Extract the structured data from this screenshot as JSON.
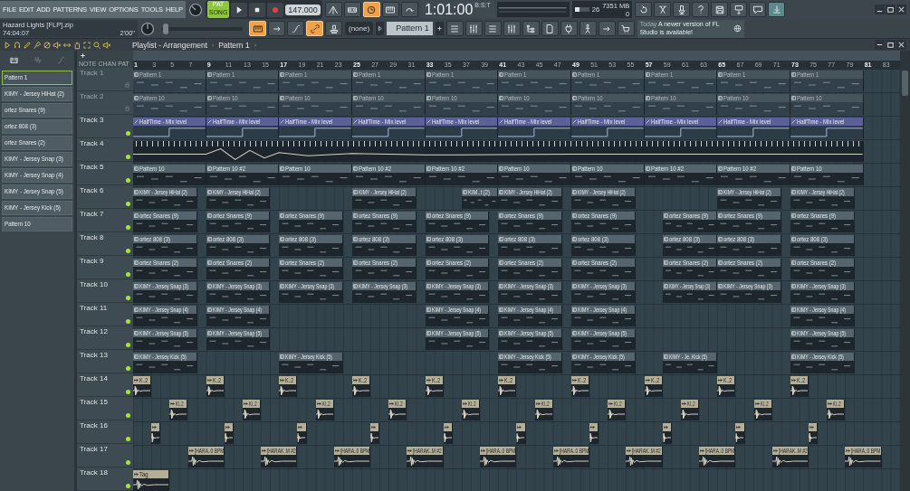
{
  "menu": [
    "FILE",
    "EDIT",
    "ADD",
    "PATTERNS",
    "VIEW",
    "OPTIONS",
    "TOOLS",
    "HELP"
  ],
  "project": {
    "file": "Hazard Lights [FLP].zip",
    "elapsed": "74:04:07",
    "length": "2'00\""
  },
  "transport": {
    "mode_song": "SONG",
    "mode_pat": "PAT",
    "song_mode": true,
    "recording": true,
    "tempo": "147.000"
  },
  "time": {
    "value": "1:01:00",
    "unit": "B:S:T"
  },
  "resources": {
    "cpu": "26",
    "memory": "7351 MB",
    "polyphony": "0",
    "level": 0.35
  },
  "pitch": {
    "level": 0.02
  },
  "buttons_top": [
    {
      "on": false
    },
    {
      "on": false
    },
    {
      "on": true
    },
    {
      "on": false
    },
    {
      "on": false
    }
  ],
  "buttons_top_right": [
    {
      "on": false
    },
    {
      "on": false
    },
    {
      "on": false
    },
    {
      "on": false
    },
    {
      "on": false
    },
    {
      "on": false
    },
    {
      "on": false
    },
    {
      "on": true
    }
  ],
  "buttons_mid": [
    {
      "on": true
    },
    {
      "on": false
    },
    {
      "on": false
    },
    {
      "on": true
    },
    {
      "on": false
    }
  ],
  "snap": "(none)",
  "pattern_selector": "Pattern 1",
  "buttons_mid_right": [
    {
      "on": false
    },
    {
      "on": false
    },
    {
      "on": false
    },
    {
      "on": false
    },
    {
      "on": false
    },
    {
      "on": false
    },
    {
      "on": false
    },
    {
      "on": false
    },
    {
      "on": false
    },
    {
      "on": false
    }
  ],
  "news": {
    "date": "Today",
    "message": "A newer version of FL Studio is available!"
  },
  "playlist": {
    "title": "Playlist - Arrangement",
    "breadcrumb": "Pattern 1",
    "modes": [
      "NOTE",
      "CHAN",
      "PAT"
    ],
    "ruler": [
      "1",
      "3",
      "5",
      "7",
      "9",
      "11",
      "13",
      "15",
      "17",
      "19",
      "21",
      "23",
      "25",
      "27",
      "29",
      "31",
      "33",
      "35",
      "37",
      "39",
      "41",
      "43",
      "45",
      "47",
      "49",
      "51",
      "53",
      "55",
      "57",
      "59",
      "61",
      "63",
      "65",
      "67",
      "69",
      "71",
      "73",
      "75",
      "77",
      "79",
      "81",
      "83"
    ]
  },
  "patterns": [
    {
      "label": "Pattern 1",
      "selected": true
    },
    {
      "label": "KIMY - Jersey HiHat (2)",
      "selected": false
    },
    {
      "label": "ortez Snares (9)",
      "selected": false
    },
    {
      "label": "ortez 808  (3)",
      "selected": false
    },
    {
      "label": "ortez Snares (2)",
      "selected": false
    },
    {
      "label": "KIMY - Jersey Snap (3)",
      "selected": false
    },
    {
      "label": "KIMY - Jersey Snap (4)",
      "selected": false
    },
    {
      "label": "KIMY - Jersey Snap (5)",
      "selected": false
    },
    {
      "label": "KIMY - Jersey Kick (5)",
      "selected": false
    },
    {
      "label": "Pattern 10",
      "selected": false
    }
  ],
  "tracks": [
    {
      "name": "Track 1",
      "enabled": false,
      "clips": [
        {
          "kind": "pattern",
          "label": "Pattern 1"
        },
        {
          "kind": "pattern",
          "label": "Pattern 1"
        },
        {
          "kind": "pattern",
          "label": "Pattern 1"
        },
        {
          "kind": "pattern",
          "label": "Pattern 1"
        },
        {
          "kind": "pattern",
          "label": "Pattern 1"
        },
        {
          "kind": "pattern",
          "label": "Pattern 1"
        },
        {
          "kind": "pattern",
          "label": "Pattern 1"
        },
        {
          "kind": "pattern",
          "label": "Pattern 1"
        },
        {
          "kind": "pattern",
          "label": "Pattern 1"
        },
        {
          "kind": "pattern",
          "label": "Pattern 1"
        }
      ]
    },
    {
      "name": "Track 2",
      "enabled": false,
      "clips": [
        {
          "kind": "pattern",
          "label": "Pattern 10"
        },
        {
          "kind": "pattern",
          "label": "Pattern 10"
        },
        {
          "kind": "pattern",
          "label": "Pattern 10"
        },
        {
          "kind": "pattern",
          "label": "Pattern 10"
        },
        {
          "kind": "pattern",
          "label": "Pattern 10"
        },
        {
          "kind": "pattern",
          "label": "Pattern 10"
        },
        {
          "kind": "pattern",
          "label": "Pattern 10"
        },
        {
          "kind": "pattern",
          "label": "Pattern 10"
        },
        {
          "kind": "pattern",
          "label": "Pattern 10"
        },
        {
          "kind": "pattern",
          "label": "Pattern 10"
        }
      ]
    },
    {
      "name": "Track 3",
      "enabled": true,
      "clips": [
        {
          "kind": "automation",
          "label": "HalfTime - Mix level"
        },
        {
          "kind": "automation",
          "label": "HalfTime - Mix level"
        },
        {
          "kind": "automation",
          "label": "HalfTime - Mix level"
        },
        {
          "kind": "automation",
          "label": "HalfTime - Mix level"
        },
        {
          "kind": "automation",
          "label": "HalfTime - Mix level"
        },
        {
          "kind": "automation",
          "label": "HalfTime - Mix level"
        },
        {
          "kind": "automation",
          "label": "HalfTime - Mix level"
        },
        {
          "kind": "automation",
          "label": "HalfTime - Mix level"
        },
        {
          "kind": "automation",
          "label": "HalfTime - Mix level"
        },
        {
          "kind": "automation",
          "label": "HalfTime - Mix level"
        }
      ]
    },
    {
      "name": "Track 4",
      "enabled": true,
      "clips": [
        {
          "kind": "strip"
        }
      ]
    },
    {
      "name": "Track 5",
      "enabled": true,
      "clips": [
        {
          "kind": "pattern",
          "label": "Pattern 10"
        },
        {
          "kind": "pattern",
          "label": "Pattern 10 #2"
        },
        {
          "kind": "pattern",
          "label": "Pattern 10"
        },
        {
          "kind": "pattern",
          "label": "Pattern 10 #2"
        },
        {
          "kind": "pattern",
          "label": "Pattern 10 #2"
        },
        {
          "kind": "pattern",
          "label": "Pattern 10"
        },
        {
          "kind": "pattern",
          "label": "Pattern 10"
        },
        {
          "kind": "pattern",
          "label": "Pattern 10 #2"
        },
        {
          "kind": "pattern",
          "label": "Pattern 10 #2"
        },
        {
          "kind": "pattern",
          "label": "Pattern 10"
        }
      ]
    },
    {
      "name": "Track 6",
      "enabled": true,
      "clips": [
        {
          "kind": "pattern",
          "label": "KIMY - Jersey HiHat (2)"
        },
        {
          "kind": "pattern",
          "label": "KIMY - Jersey HiHat (2)"
        },
        {
          "kind": "pattern",
          "label": "KIMY - Jersey HiHat (2)"
        },
        {
          "kind": "pattern",
          "label": "KIM..t (2)"
        },
        {
          "kind": "pattern",
          "label": "KIMY - Jersey HiHat (2)"
        },
        {
          "kind": "pattern",
          "label": "KIMY - Jersey HiHat (2)"
        },
        {
          "kind": "pattern",
          "label": "KIMY - Jersey HiHat (2)"
        },
        {
          "kind": "pattern",
          "label": "KIMY - Jersey HiHat (2)"
        }
      ]
    },
    {
      "name": "Track 7",
      "enabled": true,
      "clips": [
        {
          "kind": "pattern",
          "label": "ortez Snares (9)"
        },
        {
          "kind": "pattern",
          "label": "ortez Snares (9)"
        },
        {
          "kind": "pattern",
          "label": "ortez Snares (9)"
        },
        {
          "kind": "pattern",
          "label": "ortez Snares (9)"
        },
        {
          "kind": "pattern",
          "label": "ortez Snares (9)"
        },
        {
          "kind": "pattern",
          "label": "ortez Snares (9)"
        },
        {
          "kind": "pattern",
          "label": "ortez Snares (9)"
        },
        {
          "kind": "pattern",
          "label": "ortez Snares (9)"
        },
        {
          "kind": "pattern",
          "label": "ortez Snares (9)"
        },
        {
          "kind": "pattern",
          "label": "ortez Snares (9)"
        }
      ]
    },
    {
      "name": "Track 8",
      "enabled": true,
      "clips": [
        {
          "kind": "pattern",
          "label": "ortez 808  (3)"
        },
        {
          "kind": "pattern",
          "label": "ortez 808  (3)"
        },
        {
          "kind": "pattern",
          "label": "ortez 808  (3)"
        },
        {
          "kind": "pattern",
          "label": "ortez 808  (3)"
        },
        {
          "kind": "pattern",
          "label": "ortez 808  (3)"
        },
        {
          "kind": "pattern",
          "label": "ortez 808  (3)"
        },
        {
          "kind": "pattern",
          "label": "ortez 808  (3)"
        },
        {
          "kind": "pattern",
          "label": "ortez 808  (3)"
        },
        {
          "kind": "pattern",
          "label": "ortez 808  (3)"
        },
        {
          "kind": "pattern",
          "label": "ortez 808  (3)"
        }
      ]
    },
    {
      "name": "Track 9",
      "enabled": true,
      "clips": [
        {
          "kind": "pattern",
          "label": "ortez Snares (2)"
        },
        {
          "kind": "pattern",
          "label": "ortez Snares (2)"
        },
        {
          "kind": "pattern",
          "label": "ortez Snares (2)"
        },
        {
          "kind": "pattern",
          "label": "ortez Snares (2)"
        },
        {
          "kind": "pattern",
          "label": "ortez Snares (2)"
        },
        {
          "kind": "pattern",
          "label": "ortez Snares (2)"
        },
        {
          "kind": "pattern",
          "label": "ortez Snares (2)"
        },
        {
          "kind": "pattern",
          "label": "ortez Snares (2)"
        },
        {
          "kind": "pattern",
          "label": "ortez Snares (2)"
        },
        {
          "kind": "pattern",
          "label": "ortez Snares (2)"
        }
      ]
    },
    {
      "name": "Track 10",
      "enabled": true,
      "clips": [
        {
          "kind": "pattern",
          "label": "KIMY - Jersey Snap (3)"
        },
        {
          "kind": "pattern",
          "label": "KIMY - Jersey Snap (3)"
        },
        {
          "kind": "pattern",
          "label": "KIMY - Jersey Snap (3)"
        },
        {
          "kind": "pattern",
          "label": "KIMY - Jersey Snap (3)"
        },
        {
          "kind": "pattern",
          "label": "KIMY - Jersey Snap (3)"
        },
        {
          "kind": "pattern",
          "label": "KIMY - Jersey Snap (3)"
        },
        {
          "kind": "pattern",
          "label": "KIMY - Jersey Snap (3)"
        },
        {
          "kind": "pattern",
          "label": "KIMY - Jersey Snap (3)"
        },
        {
          "kind": "pattern",
          "label": "KIMY - Jersey Snap (3)"
        },
        {
          "kind": "pattern",
          "label": "KIMY - Jersey Snap (3)"
        }
      ]
    },
    {
      "name": "Track 11",
      "enabled": true,
      "clips": [
        {
          "kind": "pattern",
          "label": "KIMY - Jersey Snap (4)"
        },
        {
          "kind": "pattern",
          "label": "KIMY - Jersey Snap (4)"
        },
        {
          "kind": "pattern",
          "label": "KIMY - Jersey Snap (4)"
        },
        {
          "kind": "pattern",
          "label": "KIMY - Jersey Snap (4)"
        },
        {
          "kind": "pattern",
          "label": "KIMY - Jersey Snap (4)"
        },
        {
          "kind": "pattern",
          "label": "KIMY - Jersey Snap (4)"
        }
      ]
    },
    {
      "name": "Track 12",
      "enabled": true,
      "clips": [
        {
          "kind": "pattern",
          "label": "KIMY - Jersey Snap (5)"
        },
        {
          "kind": "pattern",
          "label": "KIMY - Jersey Snap (5)"
        },
        {
          "kind": "pattern",
          "label": "KIMY - Jersey Snap (5)"
        },
        {
          "kind": "pattern",
          "label": "KIMY - Jersey Snap (5)"
        },
        {
          "kind": "pattern",
          "label": "KIMY - Jersey Snap (5)"
        },
        {
          "kind": "pattern",
          "label": "KIMY - Jersey Snap (5)"
        }
      ]
    },
    {
      "name": "Track 13",
      "enabled": true,
      "clips": [
        {
          "kind": "pattern",
          "label": "KIMY - Jersey Kick (5)"
        },
        {
          "kind": "pattern",
          "label": "KIMY - Jersey Kick (5)"
        },
        {
          "kind": "pattern",
          "label": "KIMY - Jersey Kick (5)"
        },
        {
          "kind": "pattern",
          "label": "KIMY - Jersey Kick (5)"
        },
        {
          "kind": "pattern",
          "label": "KIMY - Je..Kick (5)"
        },
        {
          "kind": "pattern",
          "label": "KIMY - Jersey Kick (5)"
        }
      ]
    },
    {
      "name": "Track 14",
      "enabled": true,
      "clips": [
        {
          "kind": "audio",
          "label": "K..2"
        },
        {
          "kind": "audio",
          "label": "K..2"
        },
        {
          "kind": "audio",
          "label": "K..2"
        },
        {
          "kind": "audio",
          "label": "K..2"
        },
        {
          "kind": "audio",
          "label": "K..2"
        },
        {
          "kind": "audio",
          "label": "K..2"
        },
        {
          "kind": "audio",
          "label": "K..2"
        },
        {
          "kind": "audio",
          "label": "K..2"
        },
        {
          "kind": "audio",
          "label": "K..2"
        },
        {
          "kind": "audio",
          "label": "K..2"
        }
      ]
    },
    {
      "name": "Track 15",
      "enabled": true,
      "clips": [
        {
          "kind": "audio",
          "label": "KI..2"
        },
        {
          "kind": "audio",
          "label": "KI..2"
        },
        {
          "kind": "audio",
          "label": "KI..2"
        },
        {
          "kind": "audio",
          "label": "KI..2"
        },
        {
          "kind": "audio",
          "label": "KI..2"
        },
        {
          "kind": "audio",
          "label": "KI..2"
        },
        {
          "kind": "audio",
          "label": "KI..2"
        },
        {
          "kind": "audio",
          "label": "KI..2"
        },
        {
          "kind": "audio",
          "label": "KI..2"
        },
        {
          "kind": "audio",
          "label": "KI..2"
        }
      ]
    },
    {
      "name": "Track 16",
      "enabled": true,
      "clips": [
        {
          "kind": "audio"
        },
        {
          "kind": "audio"
        },
        {
          "kind": "audio"
        },
        {
          "kind": "audio"
        },
        {
          "kind": "audio"
        },
        {
          "kind": "audio"
        },
        {
          "kind": "audio"
        },
        {
          "kind": "audio"
        },
        {
          "kind": "audio"
        },
        {
          "kind": "audio"
        }
      ]
    },
    {
      "name": "Track 17",
      "enabled": true,
      "clips": [
        {
          "kind": "audio",
          "label": "[HARA..0 BPM"
        },
        {
          "kind": "audio",
          "label": "[HARAK..M #2"
        },
        {
          "kind": "audio",
          "label": "[HARA..0 BPM"
        },
        {
          "kind": "audio",
          "label": "[HARAK..M #2"
        },
        {
          "kind": "audio",
          "label": "[HARA..0 BPM"
        },
        {
          "kind": "audio",
          "label": "[HARA..0 BPM"
        },
        {
          "kind": "audio",
          "label": "[HARAK..M #2"
        },
        {
          "kind": "audio",
          "label": "[HARA..0 BPM"
        },
        {
          "kind": "audio",
          "label": "[HARAK..M #2"
        },
        {
          "kind": "audio",
          "label": "[HARA..0 BPM"
        }
      ]
    },
    {
      "name": "Track 18",
      "enabled": true,
      "clips": [
        {
          "kind": "audio",
          "label": "Tag"
        }
      ]
    }
  ]
}
